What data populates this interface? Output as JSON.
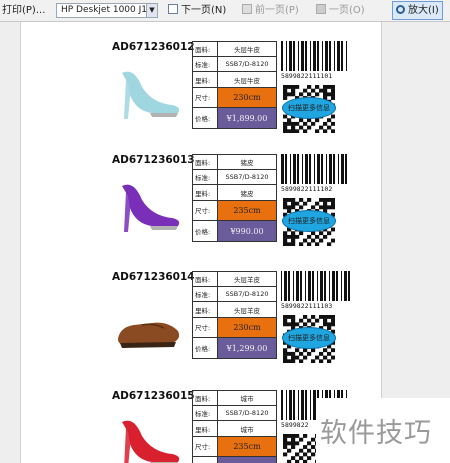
{
  "toolbar": {
    "print_label": "打印(P)...",
    "printer_value": "HP Deskjet 1000 J1",
    "next_label": "下一页(N)",
    "prev_label": "前一页(P)",
    "first_label": "一页(O)",
    "zoom_label": "放大(I)"
  },
  "table_labels": {
    "material": "面料:",
    "standard": "标准:",
    "lining": "里料:",
    "size": "尺寸:",
    "price": "价格:"
  },
  "products": [
    {
      "code": "AD671236012",
      "material": "头层牛皮",
      "standard": "SSB7/D-8120",
      "lining": "头层牛皮",
      "size": "230cm",
      "price": "¥1,899.00",
      "barcode_number": "5899822111101",
      "qr_label": "扫描更多信息",
      "shoe_color": "#9fd6e0"
    },
    {
      "code": "AD671236013",
      "material": "猪皮",
      "standard": "SSB7/D-8120",
      "lining": "猪皮",
      "size": "235cm",
      "price": "¥990.00",
      "barcode_number": "5899822111102",
      "qr_label": "扫描更多信息",
      "shoe_color": "#7a2fb8"
    },
    {
      "code": "AD671236014",
      "material": "头层羊皮",
      "standard": "SSB7/D-8120",
      "lining": "头层羊皮",
      "size": "230cm",
      "price": "¥1,299.00",
      "barcode_number": "5899822111103",
      "qr_label": "扫描更多信息",
      "shoe_color": "#8a4a22"
    },
    {
      "code": "AD671236015",
      "material": "城市",
      "standard": "SSB7/D-8120",
      "lining": "城市",
      "size": "235cm",
      "price": "",
      "barcode_number": "5899822",
      "qr_label": "",
      "shoe_color": "#d8202e"
    }
  ],
  "watermark": "软件技巧"
}
